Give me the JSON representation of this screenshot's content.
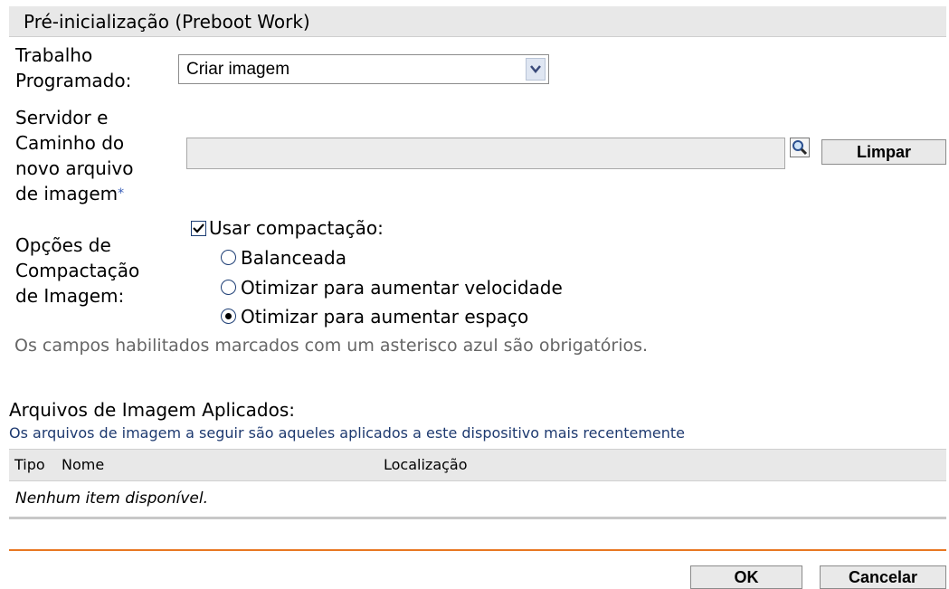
{
  "panel": {
    "title": "Pré-inicialização (Preboot Work)"
  },
  "form": {
    "scheduled_job_label_line1": "Trabalho",
    "scheduled_job_label_line2": "Programado:",
    "scheduled_job_value": "Criar imagem",
    "server_path_label_line1": "Servidor e",
    "server_path_label_line2": "Caminho do",
    "server_path_label_line3": "novo arquivo",
    "server_path_label_line4": "de imagem",
    "required_marker": "*",
    "server_path_value": "",
    "clear_button": "Limpar",
    "compression_label_line1": "Opções de",
    "compression_label_line2": "Compactação",
    "compression_label_line3": "de Imagem:",
    "use_compression_label": "Usar compactação:",
    "use_compression_checked": true,
    "options": [
      {
        "label": "Balanceada",
        "selected": false
      },
      {
        "label": "Otimizar para aumentar velocidade",
        "selected": false
      },
      {
        "label": "Otimizar para aumentar espaço",
        "selected": true
      }
    ],
    "required_note": "Os campos habilitados marcados com um asterisco azul são obrigatórios."
  },
  "applied_images": {
    "heading": "Arquivos de Imagem Aplicados:",
    "subheading": "Os arquivos de imagem a seguir são aqueles aplicados a este dispositivo mais recentemente",
    "columns": [
      "Tipo",
      "Nome",
      "Localização"
    ],
    "empty_message": "Nenhum item disponível."
  },
  "footer": {
    "ok": "OK",
    "cancel": "Cancelar"
  },
  "colors": {
    "accent_orange": "#e87722",
    "required_blue": "#3a5fb8",
    "link_blue": "#1e3a70"
  },
  "icons": {
    "select_arrow": "chevron-down-icon",
    "browse": "magnifier-icon",
    "check": "checkmark-icon"
  }
}
